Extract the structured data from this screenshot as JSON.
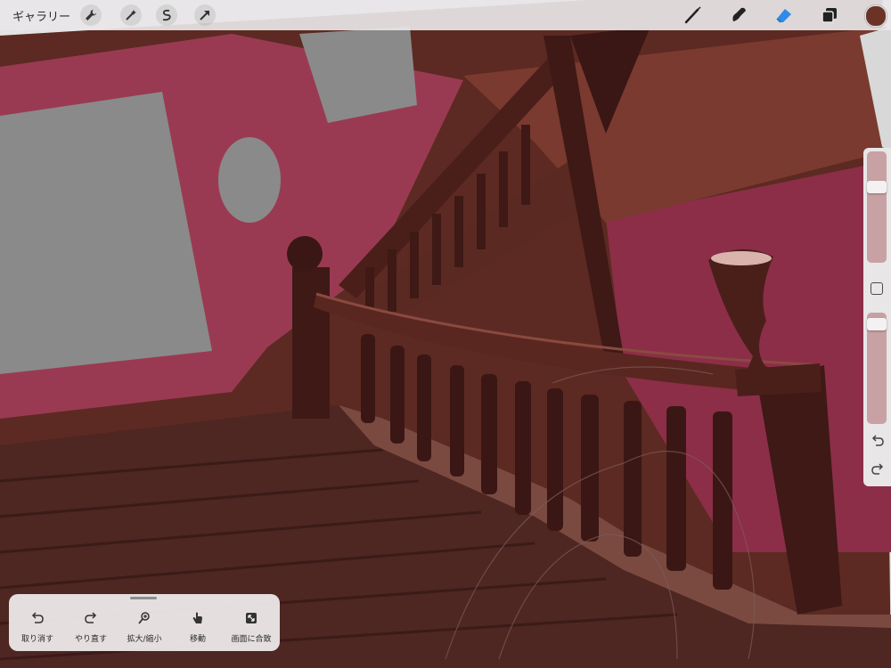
{
  "topbar": {
    "gallery_label": "ギャラリー",
    "left_tools": [
      "wrench-icon",
      "magic-wand-icon",
      "selection-icon",
      "transform-arrow-icon"
    ],
    "right_tools": [
      "brush-icon",
      "smudge-icon",
      "eraser-icon",
      "layers-icon"
    ],
    "active_tool": "eraser-icon",
    "current_color": "#6b3328",
    "accent_color": "#2f8ae8"
  },
  "sidebar": {
    "brush_size_level": 0.7,
    "opacity_level": 0.95
  },
  "quickmenu": {
    "items": [
      {
        "icon": "undo-icon",
        "label": "取り消す"
      },
      {
        "icon": "redo-icon",
        "label": "やり直す"
      },
      {
        "icon": "zoom-icon",
        "label": "拡大/縮小"
      },
      {
        "icon": "hand-icon",
        "label": "移動"
      },
      {
        "icon": "fit-screen-icon",
        "label": "画面に合致"
      }
    ]
  }
}
